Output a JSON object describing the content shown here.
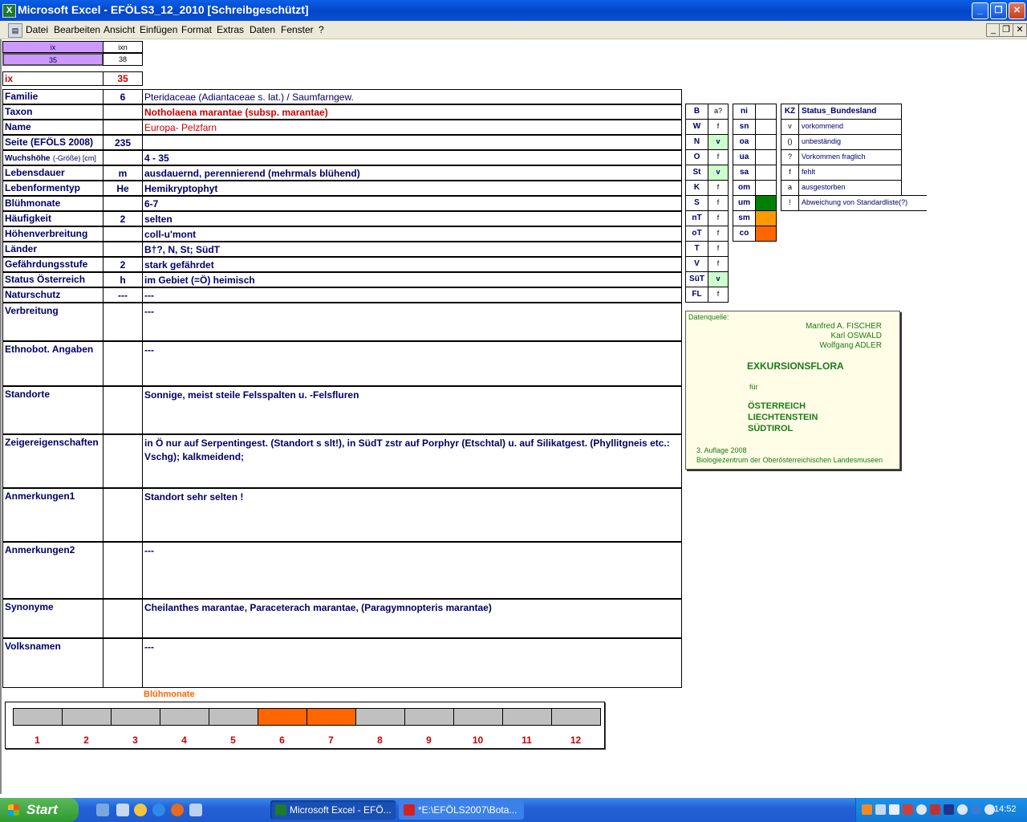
{
  "window": {
    "title": "Microsoft Excel - EFÖLS3_12_2010  [Schreibgeschützt]",
    "app_icon": "excel-icon"
  },
  "menu": [
    "Datei",
    "Bearbeiten",
    "Ansicht",
    "Einfügen",
    "Format",
    "Extras",
    "Daten",
    "Fenster",
    "?"
  ],
  "index_box": {
    "h1": "ix",
    "h2": "ixn",
    "v1": "35",
    "v2": "38",
    "ix_label": "ix",
    "ix_value": "35"
  },
  "rows": [
    {
      "label": "Familie",
      "code": "6",
      "value": "Pteridaceae (Adiantaceae s. lat.)  /  Saumfarngew."
    },
    {
      "label": "Taxon",
      "code": "",
      "value": "Notholaena marantae (subsp. marantae)"
    },
    {
      "label": "Name",
      "code": "",
      "value": "Europa- Pelzfarn"
    },
    {
      "label": "Seite (EFÖLS 2008)",
      "code": "235",
      "value": ""
    },
    {
      "label": "Wuchshöhe",
      "label_suffix": "(-Größe) [cm]",
      "code": "",
      "value": " 4 - 35"
    },
    {
      "label": "Lebensdauer",
      "code": "m",
      "value": "ausdauernd, perennierend (mehrmals blühend)"
    },
    {
      "label": "Lebenformentyp",
      "code": "He",
      "value": "Hemikryptophyt"
    },
    {
      "label": "Blühmonate",
      "code": "",
      "value": " 6-7"
    },
    {
      "label": "Häufigkeit",
      "code": "2",
      "value": "selten"
    },
    {
      "label": "Höhenverbreitung",
      "code": "",
      "value": "coll-u'mont"
    },
    {
      "label": "Länder",
      "code": "",
      "value": "B†?, N, St; SüdT"
    },
    {
      "label": "Gefährdungsstufe",
      "code": "2",
      "value": "stark gefährdet"
    },
    {
      "label": "Status Österreich",
      "code": "h",
      "value": "im Gebiet (=Ö) heimisch"
    },
    {
      "label": "Naturschutz",
      "code": "---",
      "value": " ---"
    }
  ],
  "big_rows": [
    {
      "label": "Verbreitung",
      "value": " ---"
    },
    {
      "label": "Ethnobot. Angaben",
      "value": "---"
    },
    {
      "label": "Standorte",
      "value": "Sonnige, meist steile Felsspalten u. -Felsfluren"
    },
    {
      "label": "Zeigereigenschaften",
      "value": "in Ö nur auf Serpentingest. (Standort s slt!), in SüdT zstr auf Porphyr (Etschtal) u. auf Silikatgest. (Phyllitgneis etc.: Vschg); kalkmeidend;"
    },
    {
      "label": "Anmerkungen1",
      "value": "Standort sehr selten !"
    },
    {
      "label": "Anmerkungen2",
      "value": "---"
    },
    {
      "label": "Synonyme",
      "value": "Cheilanthes marantae, Paraceterach marantae, (Paragymnopteris marantae)"
    },
    {
      "label": "Volksnamen",
      "value": "---"
    }
  ],
  "states": [
    {
      "code": "B",
      "val": "a?"
    },
    {
      "code": "W",
      "val": "f"
    },
    {
      "code": "N",
      "val": "v"
    },
    {
      "code": "O",
      "val": "f"
    },
    {
      "code": "St",
      "val": "v"
    },
    {
      "code": "K",
      "val": "f"
    },
    {
      "code": "S",
      "val": "f"
    },
    {
      "code": "nT",
      "val": "f"
    },
    {
      "code": "oT",
      "val": "f"
    },
    {
      "code": "T",
      "val": "f"
    },
    {
      "code": "V",
      "val": "f"
    },
    {
      "code": "SüT",
      "val": "v"
    },
    {
      "code": "FL",
      "val": "f"
    }
  ],
  "altitude": [
    {
      "code": "ni",
      "color": ""
    },
    {
      "code": "sn",
      "color": ""
    },
    {
      "code": "oa",
      "color": ""
    },
    {
      "code": "ua",
      "color": ""
    },
    {
      "code": "sa",
      "color": ""
    },
    {
      "code": "om",
      "color": ""
    },
    {
      "code": "um",
      "color": "#008000"
    },
    {
      "code": "sm",
      "color": "#ff9900"
    },
    {
      "code": "co",
      "color": "#ff6600"
    }
  ],
  "legend": {
    "header_kz": "KZ",
    "header_status": "Status_Bundesland",
    "items": [
      {
        "kz": "v",
        "text": "vorkommend"
      },
      {
        "kz": "()",
        "text": "unbeständig"
      },
      {
        "kz": "?",
        "text": "Vorkommen fraglich"
      },
      {
        "kz": "f",
        "text": "fehlt"
      },
      {
        "kz": "a",
        "text": "ausgestorben"
      },
      {
        "kz": "!",
        "text": "Abweichung von Standardliste(?)"
      }
    ]
  },
  "datasource": {
    "label": "Datenquelle:",
    "authors": [
      "Manfred A. FISCHER",
      "Karl OSWALD",
      "Wolfgang ADLER"
    ],
    "title": "EXKURSIONSFLORA",
    "fuer": "für",
    "countries": [
      "ÖSTERREICH",
      "LIECHTENSTEIN",
      "SÜDTIROL"
    ],
    "edition": "3. Auflage 2008",
    "publisher": "Biologiezentrum der Oberösterreichischen Landesmuseen"
  },
  "bloom_chart": {
    "title": "Blühmonate",
    "months": [
      "1",
      "2",
      "3",
      "4",
      "5",
      "6",
      "7",
      "8",
      "9",
      "10",
      "11",
      "12"
    ],
    "active": [
      6,
      7
    ],
    "active_color": "#ff6600",
    "inactive_color": "#c0c0c0"
  },
  "taskbar": {
    "start": "Start",
    "apps": [
      "Microsoft Excel - EFÖ...",
      "*E:\\EFÖLS2007\\Bota..."
    ],
    "clock": "14:52"
  }
}
